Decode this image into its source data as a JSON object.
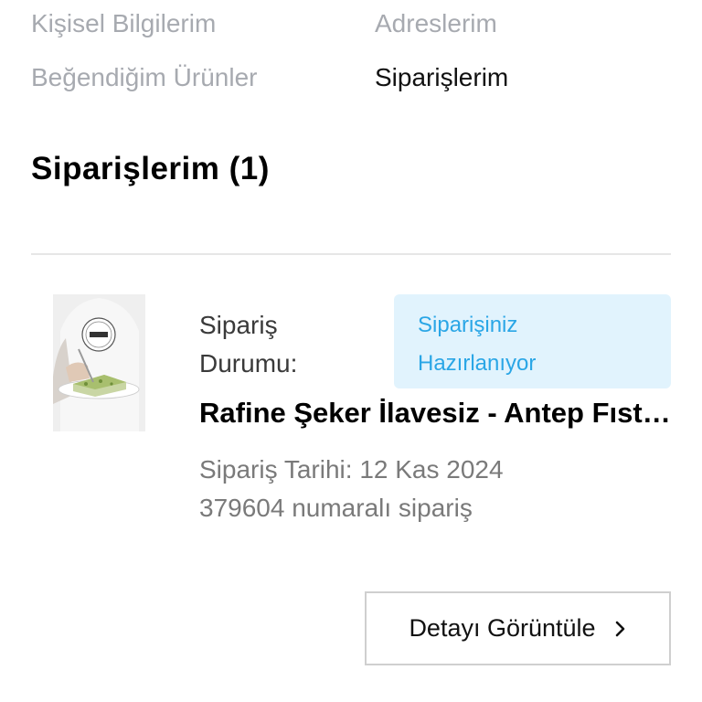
{
  "account_nav": {
    "personal_info": "Kişisel Bilgilerim",
    "addresses": "Adreslerim",
    "favorites": "Beğendiğim Ürünler",
    "orders": "Siparişlerim",
    "active": "orders"
  },
  "page": {
    "title": "Siparişlerim (1)"
  },
  "order": {
    "status_label": "Sipariş Durumu:",
    "status_value": "Siparişiniz Hazırlanıyor",
    "product_name": "Rafine Şeker İlavesiz - Antep Fıstıklı Helva",
    "date_text": "Sipariş Tarihi: 12 Kas 2024",
    "number_text": "379604 numaralı sipariş",
    "detail_button_label": "Detayı Görüntüle",
    "detail_button_icon": "chevron-right-icon"
  },
  "colors": {
    "nav_inactive": "#a7aab0",
    "status_badge_bg": "#e1f3fd",
    "status_badge_text": "#2aa6e6",
    "button_border": "#cfcfcf"
  }
}
